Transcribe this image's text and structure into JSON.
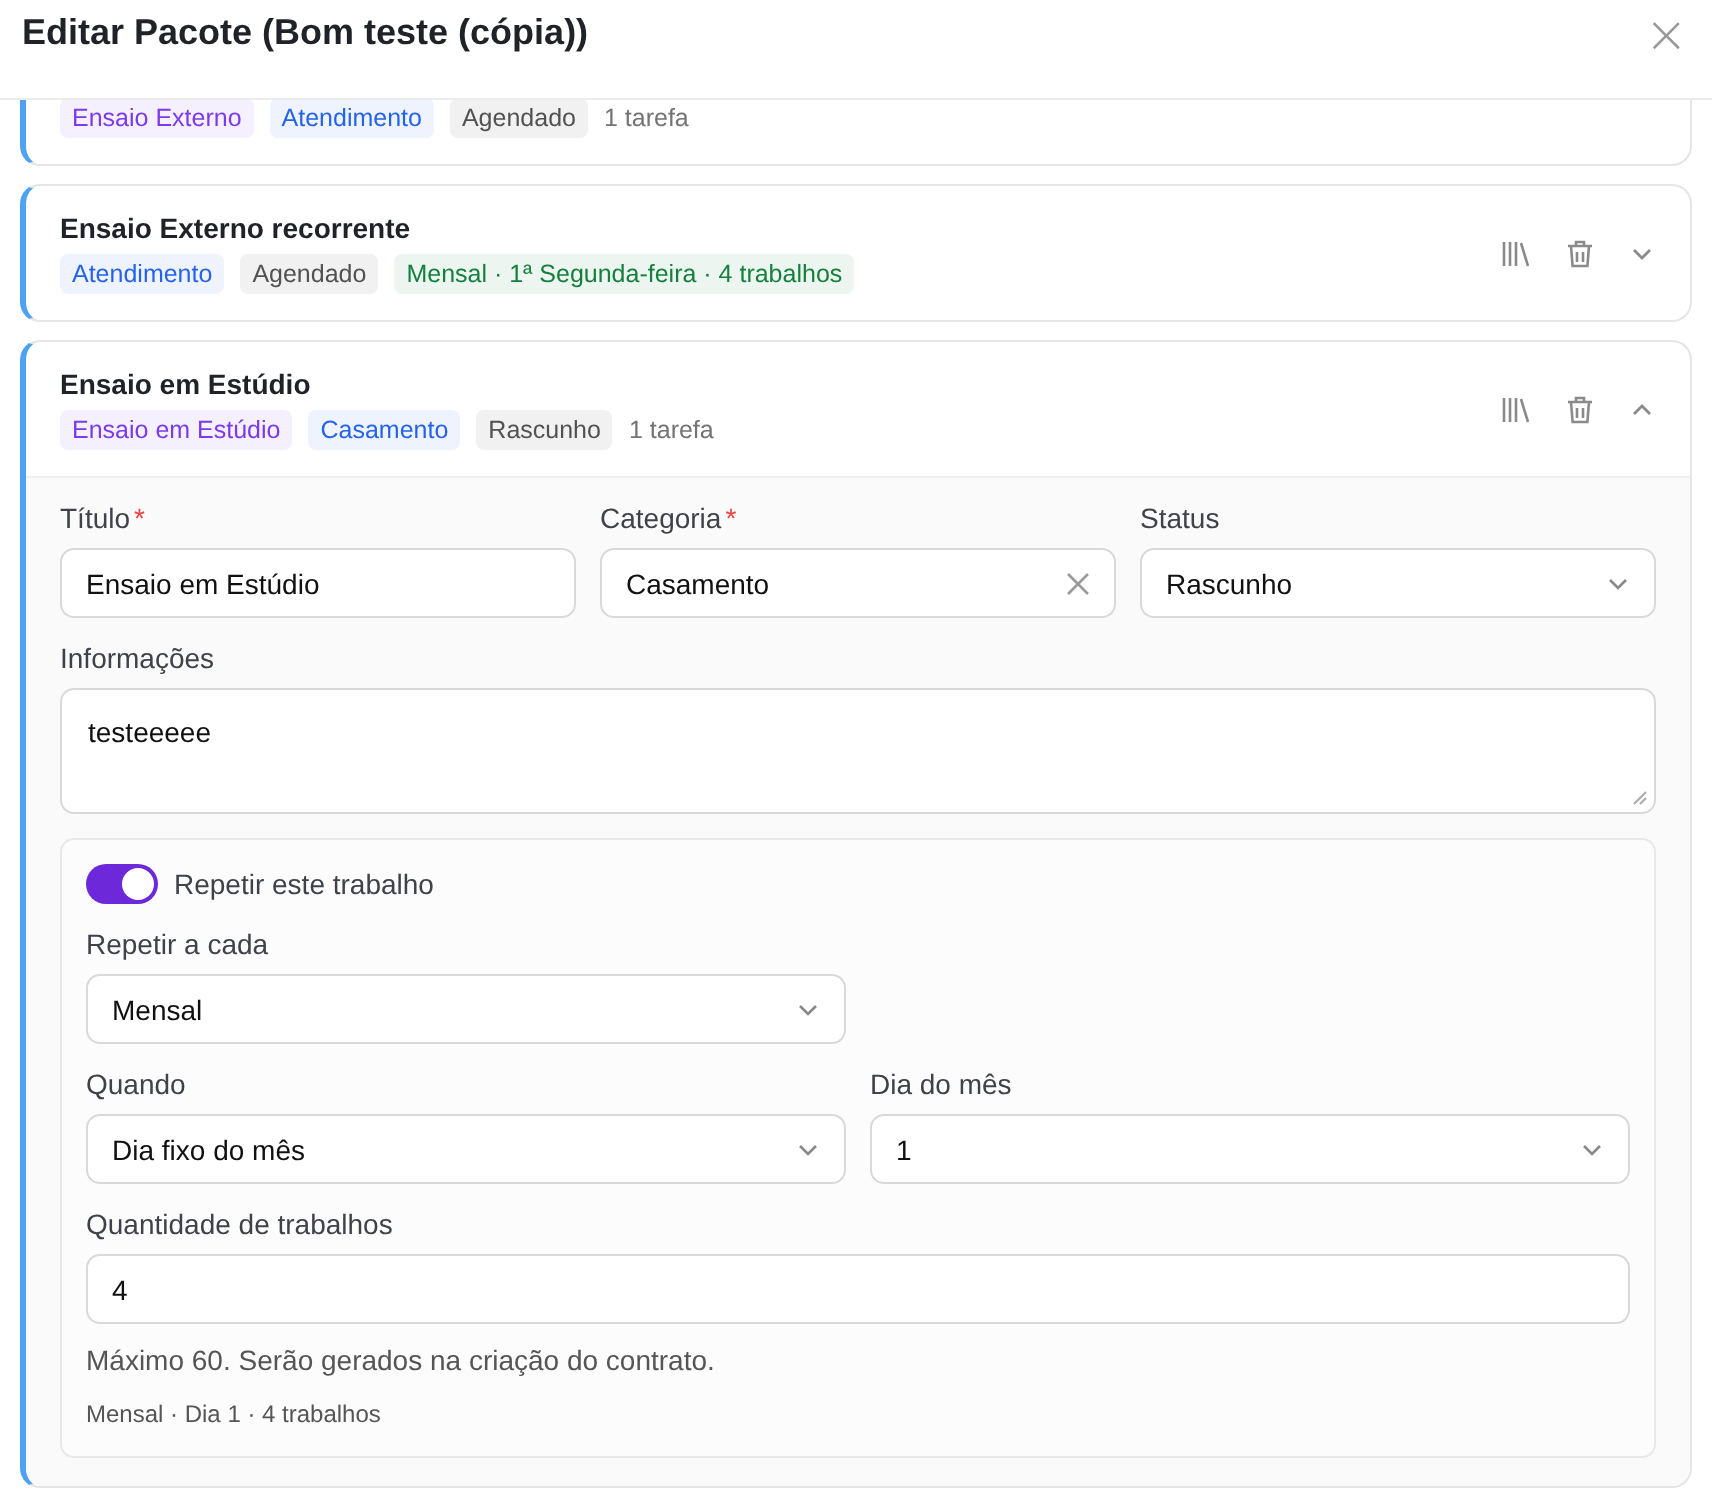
{
  "dialog": {
    "title": "Editar Pacote (Bom teste (cópia))",
    "close": "×"
  },
  "items": [
    {
      "tags": [
        {
          "kind": "tag",
          "label": "Ensaio Externo",
          "color": "#7c3aed"
        },
        {
          "kind": "tag",
          "label": "Atendimento",
          "color": "#2563eb"
        },
        {
          "kind": "tag",
          "label": "Agendado",
          "color": "#525252"
        },
        {
          "kind": "text",
          "label": "1 tarefa",
          "color": "#737373"
        }
      ]
    },
    {
      "title": "Ensaio Externo recorrente",
      "expanded": false,
      "tags": [
        {
          "kind": "tag",
          "label": "Atendimento",
          "color": "#2563eb"
        },
        {
          "kind": "tag",
          "label": "Agendado",
          "color": "#525252"
        },
        {
          "kind": "tag",
          "label": "Mensal · 1ª Segunda-feira · 4 trabalhos",
          "color": "#15803d"
        }
      ]
    },
    {
      "title": "Ensaio em Estúdio",
      "expanded": true,
      "tags": [
        {
          "kind": "tag",
          "label": "Ensaio em Estúdio",
          "color": "#7c3aed"
        },
        {
          "kind": "tag",
          "label": "Casamento",
          "color": "#2563eb"
        },
        {
          "kind": "tag",
          "label": "Rascunho",
          "color": "#525252"
        },
        {
          "kind": "text",
          "label": "1 tarefa",
          "color": "#737373"
        }
      ]
    }
  ],
  "form": {
    "fields": [
      {
        "label": "Título",
        "required_mark": "*",
        "kind": "text",
        "value": "Ensaio em Estúdio"
      },
      {
        "label": "Categoria",
        "required_mark": "*",
        "kind": "clearable",
        "value": "Casamento"
      },
      {
        "label": "Status",
        "kind": "select",
        "value": "Rascunho"
      }
    ],
    "info": {
      "label": "Informações",
      "value": "testeeeee"
    },
    "repeat": {
      "toggle": {
        "label": "Repetir este trabalho",
        "on": true
      },
      "every": {
        "label": "Repetir a cada",
        "value": "Mensal"
      },
      "when": {
        "label": "Quando",
        "value": "Dia fixo do mês"
      },
      "day": {
        "label": "Dia do mês",
        "value": "1"
      },
      "count": {
        "label": "Quantidade de trabalhos",
        "value": "4"
      },
      "hint": "Máximo 60. Serão gerados na criação do contrato.",
      "summary": "Mensal · Dia 1 · 4 trabalhos"
    }
  }
}
